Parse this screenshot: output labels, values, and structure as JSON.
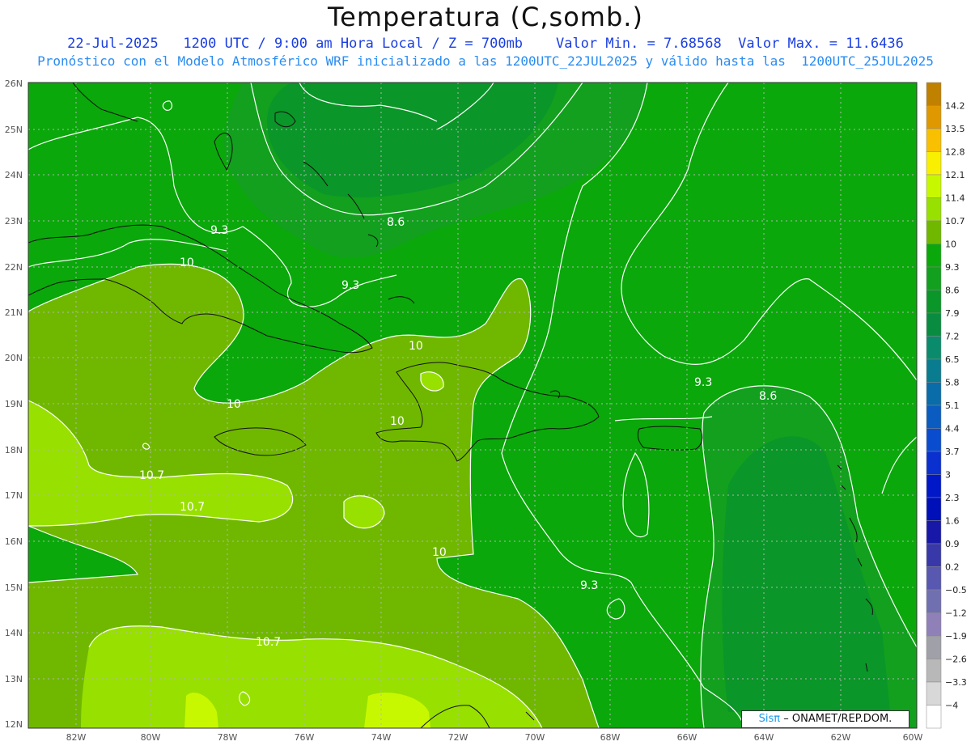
{
  "title": "Temperatura (C,somb.)",
  "subtitle_line1": "22-Jul-2025   1200 UTC / 9:00 am Hora Local / Z = 700mb    Valor Min. = 7.68568  Valor Max. = 11.6436",
  "subtitle_line2": "Pronóstico con el Modelo Atmosférico WRF inicializado a las 1200UTC_22JUL2025 y válido hasta las  1200UTC_25JUL2025",
  "credit": {
    "logo": "Sisπ",
    "text": "– ONAMET/REP.DOM."
  },
  "map": {
    "lon_labels": [
      "82W",
      "80W",
      "78W",
      "76W",
      "74W",
      "72W",
      "70W",
      "68W",
      "66W",
      "64W",
      "62W",
      "60W"
    ],
    "lat_labels": [
      "26N",
      "25N",
      "24N",
      "23N",
      "22N",
      "21N",
      "20N",
      "19N",
      "18N",
      "17N",
      "16N",
      "15N",
      "14N",
      "13N",
      "12N"
    ],
    "contour_labels": [
      {
        "text": "9.3"
      },
      {
        "text": "8.6"
      },
      {
        "text": "10"
      },
      {
        "text": "9.3"
      },
      {
        "text": "10"
      },
      {
        "text": "10"
      },
      {
        "text": "10"
      },
      {
        "text": "10.7"
      },
      {
        "text": "10.7"
      },
      {
        "text": "10"
      },
      {
        "text": "9.3"
      },
      {
        "text": "9.3"
      },
      {
        "text": "8.6"
      },
      {
        "text": "10.7"
      }
    ]
  },
  "colorbar": {
    "labels": [
      "14.2",
      "13.5",
      "12.8",
      "12.1",
      "11.4",
      "10.7",
      "10",
      "9.3",
      "8.6",
      "7.9",
      "7.2",
      "6.5",
      "5.8",
      "5.1",
      "4.4",
      "3.7",
      "3",
      "2.3",
      "1.6",
      "0.9",
      "0.2",
      "−0.5",
      "−1.2",
      "−1.9",
      "−2.6",
      "−3.3",
      "−4"
    ],
    "colors": [
      "#c08000",
      "#e09800",
      "#f8c000",
      "#f8f000",
      "#c8f800",
      "#98e000",
      "#70b800",
      "#0aa80a",
      "#12a01e",
      "#0a9628",
      "#0a8c40",
      "#0a8c6c",
      "#0a7c90",
      "#0a6ca8",
      "#0a5cc0",
      "#0a4cd0",
      "#0a30d0",
      "#0018c8",
      "#0010b8",
      "#1818a8",
      "#3838a8",
      "#5858b0",
      "#7070b0",
      "#9080b8",
      "#a0a0a8",
      "#b8b8b8",
      "#d8d8d8",
      "#ffffff"
    ]
  }
}
